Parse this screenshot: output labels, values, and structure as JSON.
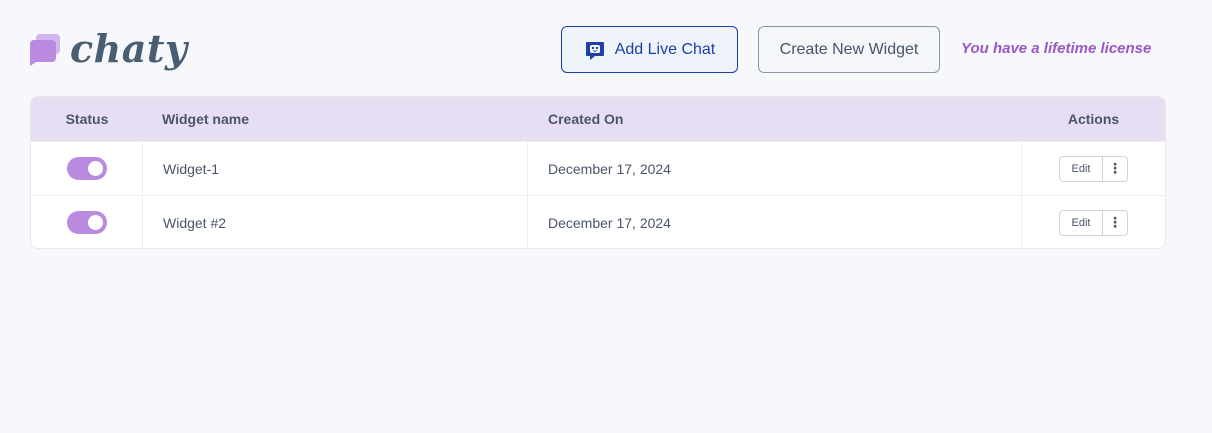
{
  "brand": {
    "name": "chaty",
    "color": "#b98ae0"
  },
  "header": {
    "add_live_chat": "Add Live Chat",
    "create_widget": "Create New Widget",
    "license": "You have a lifetime license"
  },
  "table": {
    "columns": [
      "Status",
      "Widget name",
      "Created On",
      "Actions"
    ],
    "rows": [
      {
        "status": "on",
        "name": "Widget-1",
        "created": "December 17, 2024",
        "edit": "Edit",
        "more": "⋮"
      },
      {
        "status": "on",
        "name": "Widget #2",
        "created": "December 17, 2024",
        "edit": "Edit",
        "more": "⋮"
      }
    ]
  },
  "icons": {
    "logo": "chat-bubbles-icon",
    "live_chat": "chatbot-icon",
    "more": "kebab-menu-icon"
  }
}
